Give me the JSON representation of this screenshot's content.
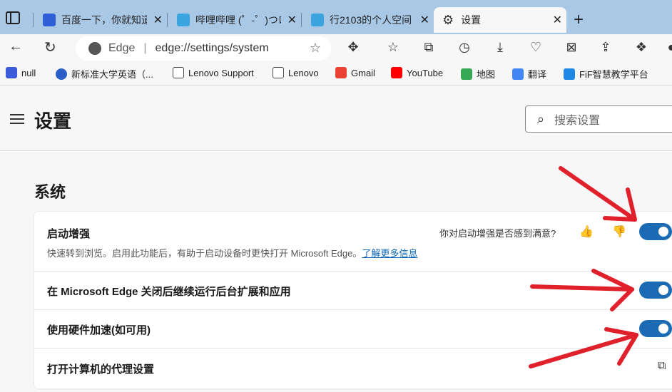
{
  "tabs": [
    {
      "label": "百度一下，你就知道",
      "active": false
    },
    {
      "label": "哔哩哔哩 (゜-゜)つロ",
      "active": false
    },
    {
      "label": "行2103的个人空间",
      "active": false
    },
    {
      "label": "设置",
      "active": true
    }
  ],
  "address": {
    "brand": "Edge",
    "url": "edge://settings/system"
  },
  "bookmarks": [
    "null",
    "新标准大学英语（...",
    "Lenovo Support",
    "Lenovo",
    "Gmail",
    "YouTube",
    "地图",
    "翻译",
    "FiF智慧教学平台"
  ],
  "settings": {
    "title": "设置",
    "search_placeholder": "搜索设置",
    "section": "系统",
    "rows": [
      {
        "title": "启动增强",
        "desc": "快速转到浏览。启用此功能后，有助于启动设备时更快打开 Microsoft Edge。",
        "link": "了解更多信息",
        "feedback": "你对启动增强是否感到满意?",
        "enabled": true
      },
      {
        "title": "在 Microsoft Edge 关闭后继续运行后台扩展和应用",
        "enabled": true
      },
      {
        "title": "使用硬件加速(如可用)",
        "enabled": true
      },
      {
        "title": "打开计算机的代理设置"
      }
    ]
  },
  "colors": {
    "accent": "#1a6ab4",
    "arrow": "#e0202a",
    "tabstrip": "#a9c8e6"
  }
}
